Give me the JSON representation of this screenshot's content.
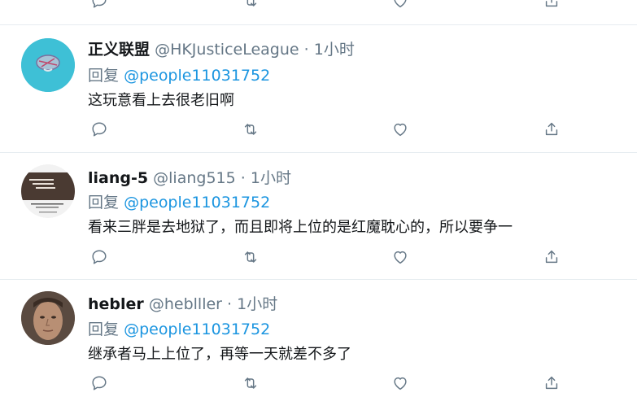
{
  "tweets": [
    {
      "name": "正义联盟",
      "handle": "@HKJusticeLeague",
      "time": "1小时",
      "reply_prefix": "回复",
      "reply_to": "@people11031752",
      "text": "这玩意看上去很老旧啊",
      "avatar": "globe-logo-avatar"
    },
    {
      "name": "liang-5",
      "handle": "@liang515",
      "time": "1小时",
      "reply_prefix": "回复",
      "reply_to": "@people11031752",
      "text": "看来三胖是去地狱了，而且即将上位的是红魔耽心的，所以要争一",
      "avatar": "book-cover-avatar"
    },
    {
      "name": "hebler",
      "handle": "@heblller",
      "time": "1小时",
      "reply_prefix": "回复",
      "reply_to": "@people11031752",
      "text": "继承者马上上位了，再等一天就差不多了",
      "avatar": "face-photo-avatar"
    }
  ],
  "dot": "·",
  "icons": [
    "reply-icon",
    "retweet-icon",
    "like-icon",
    "share-icon"
  ],
  "colors": {
    "mention": "#1b95e0",
    "muted": "#657786",
    "divider": "#e6ecf0"
  }
}
